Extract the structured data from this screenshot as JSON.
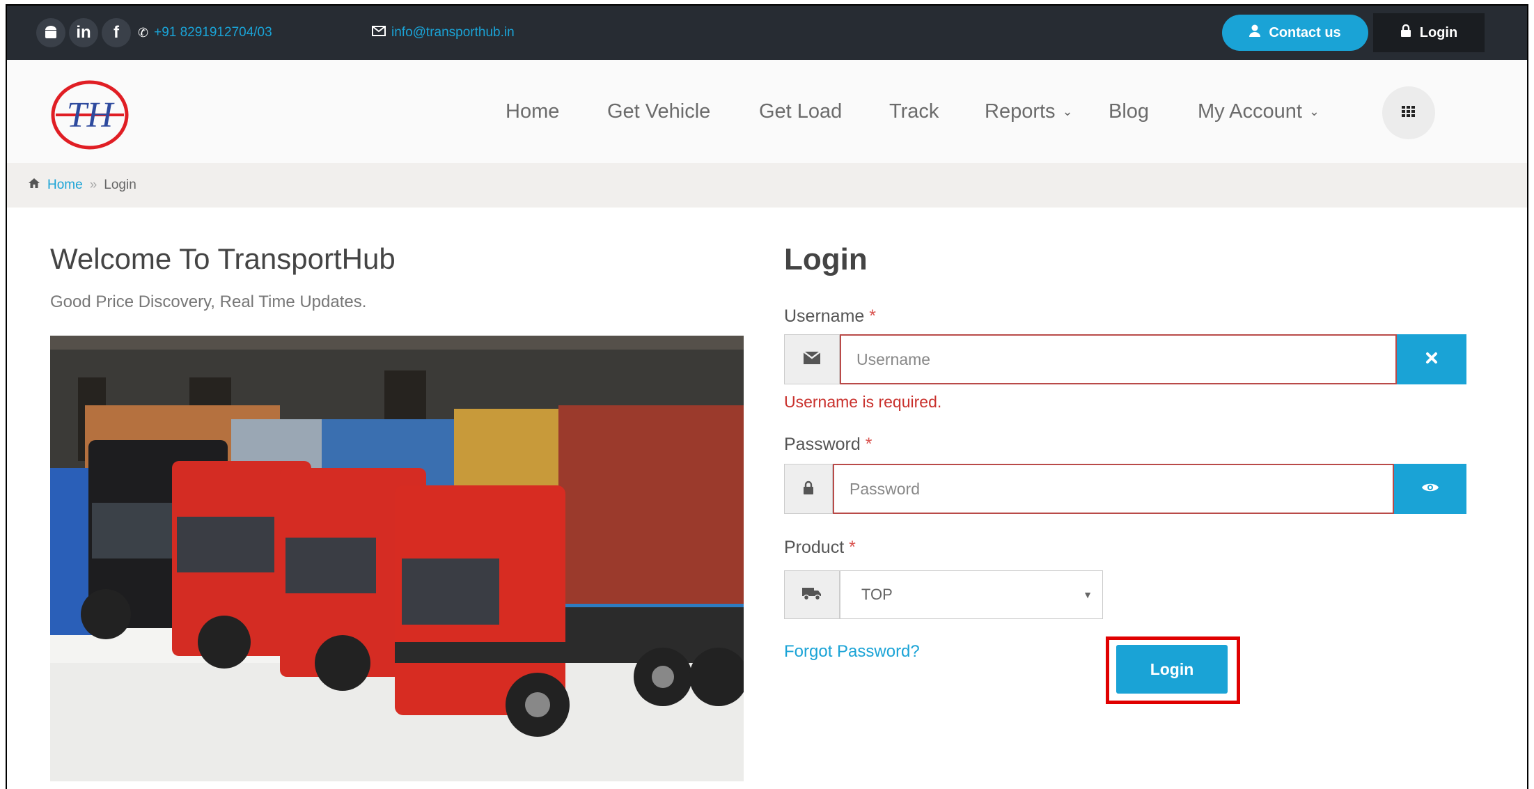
{
  "topbar": {
    "social": [
      {
        "icon": "android-icon",
        "glyph": ""
      },
      {
        "icon": "linkedin-icon",
        "glyph": "in"
      },
      {
        "icon": "facebook-icon",
        "glyph": "f"
      }
    ],
    "phone": "+91 8291912704/03",
    "email": "info@transporthub.in",
    "contact_label": "Contact us",
    "login_label": "Login"
  },
  "brand": {
    "logo_text": "TH"
  },
  "nav": {
    "items": [
      {
        "label": "Home"
      },
      {
        "label": "Get Vehicle"
      },
      {
        "label": "Get Load"
      },
      {
        "label": "Track"
      },
      {
        "label": "Reports",
        "dropdown": true
      },
      {
        "label": "Blog"
      },
      {
        "label": "My Account",
        "dropdown": true
      }
    ]
  },
  "breadcrumb": {
    "home": "Home",
    "separator": "»",
    "current": "Login"
  },
  "intro": {
    "title": "Welcome To TransportHub",
    "tagline": "Good Price Discovery, Real Time Updates."
  },
  "form": {
    "title": "Login",
    "username": {
      "label": "Username",
      "placeholder": "Username",
      "value": "",
      "error": "Username is required."
    },
    "password": {
      "label": "Password",
      "placeholder": "Password",
      "value": ""
    },
    "product": {
      "label": "Product",
      "selected": "TOP"
    },
    "required_marker": "*",
    "forgot_label": "Forgot Password?",
    "submit_label": "Login"
  },
  "colors": {
    "accent": "#1aa3d6",
    "topbar": "#272c33",
    "error": "#c9302c",
    "highlight": "#e00000"
  }
}
